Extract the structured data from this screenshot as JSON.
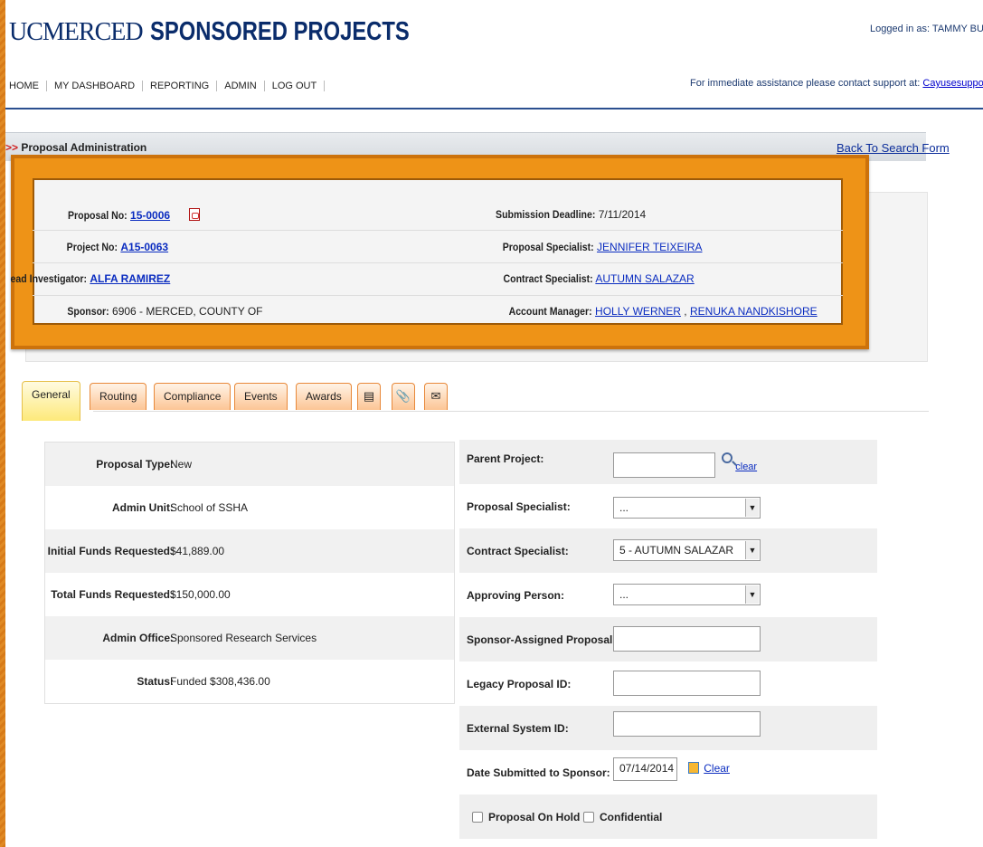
{
  "header": {
    "logo_uc": "UCMERCED",
    "logo_title": "SPONSORED PROJECTS",
    "logged_in": "Logged in as: TAMMY BURGES",
    "assist_text": "For immediate assistance please contact support at:",
    "assist_email": "Cayusesupport@ucmerced."
  },
  "nav": [
    "HOME",
    "MY DASHBOARD",
    "REPORTING",
    "ADMIN",
    "LOG OUT"
  ],
  "admin_bar": {
    "title": "Proposal Administration",
    "back_link": "Back To Search Form"
  },
  "summary": {
    "proposal_no_label": "Proposal No:",
    "proposal_no": "15-0006",
    "project_no_label": "Project No:",
    "project_no": "A15-0063",
    "lead_inv_label": "ead Investigator:",
    "lead_inv": "ALFA RAMIREZ",
    "sponsor_label": "Sponsor:",
    "sponsor": "6906 - MERCED, COUNTY OF",
    "deadline_label": "Submission Deadline:",
    "deadline": "7/11/2014",
    "prop_spec_label": "Proposal Specialist:",
    "prop_spec": "JENNIFER TEIXEIRA",
    "contract_spec_label": "Contract Specialist:",
    "contract_spec": "AUTUMN SALAZAR",
    "acct_mgr_label": "Account Manager:",
    "acct_mgr_1": "HOLLY WERNER",
    "acct_mgr_sep": ",",
    "acct_mgr_2": "RENUKA NANDKISHORE"
  },
  "tabs": [
    "General",
    "Routing",
    "Compliance",
    "Events",
    "Awards"
  ],
  "tab_icons": [
    "document-icon",
    "paperclip-icon",
    "envelope-icon"
  ],
  "general_left": [
    {
      "label": "Proposal Type:",
      "value": "New"
    },
    {
      "label": "Admin Unit:",
      "value": "School of SSHA"
    },
    {
      "label": "Initial Funds Requested:",
      "value": "$41,889.00"
    },
    {
      "label": "Total Funds Requested:",
      "value": "$150,000.00"
    },
    {
      "label": "Admin Office:",
      "value": "Sponsored Research Services"
    },
    {
      "label": "Status:",
      "value": "Funded $308,436.00"
    }
  ],
  "general_right": {
    "parent_project_label": "Parent Project:",
    "parent_project_value": "",
    "clear_link": "clear",
    "proposal_specialist_label": "Proposal Specialist:",
    "proposal_specialist_value": "...",
    "contract_specialist_label": "Contract Specialist:",
    "contract_specialist_value": "5 - AUTUMN SALAZAR",
    "approving_person_label": "Approving Person:",
    "approving_person_value": "...",
    "sponsor_assigned_label": "Sponsor-Assigned Proposal No:",
    "sponsor_assigned_value": "",
    "legacy_id_label": "Legacy Proposal ID:",
    "legacy_id_value": "",
    "external_id_label": "External System ID:",
    "external_id_value": "",
    "date_submitted_label": "Date Submitted to Sponsor:",
    "date_submitted_value": "07/14/2014",
    "date_clear_link": "Clear",
    "on_hold_label": "Proposal On Hold",
    "confidential_label": "Confidential"
  }
}
